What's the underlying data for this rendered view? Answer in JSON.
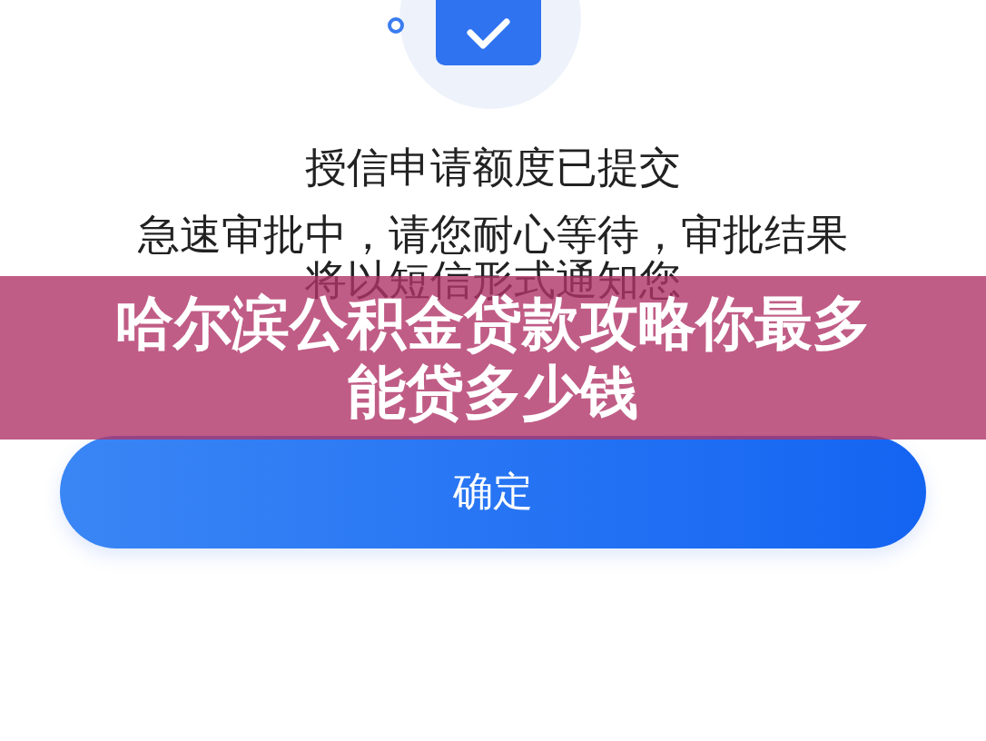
{
  "title": "授信申请额度已提交",
  "message": "急速审批中，请您耐心等待，审批结果将以短信形式通知您",
  "confirm_button": "确定",
  "banner": {
    "headline": "哈尔滨公积金贷款攻略你最多能贷多少钱"
  }
}
